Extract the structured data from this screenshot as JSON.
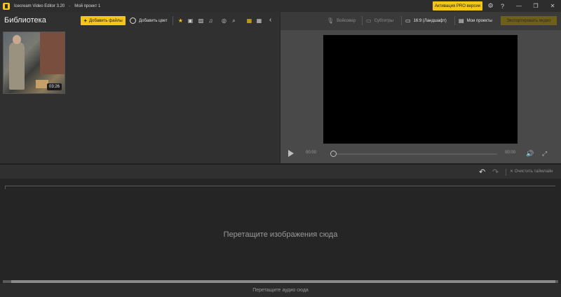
{
  "titlebar": {
    "app_name": "Icecream Video Editor 3.20",
    "separator": "-",
    "project_name": "Мой проект 1",
    "pro_button": "Активация PRO версии",
    "icons": [
      "gear-icon",
      "help-icon"
    ],
    "window_buttons": [
      "minimize",
      "maximize",
      "close"
    ]
  },
  "library": {
    "title": "Библиотека",
    "add_files": "Добавить файлы",
    "add_color": "Добавить цвет",
    "filters": [
      "star-icon",
      "video-icon",
      "image-icon",
      "music-icon",
      "color-icon",
      "search-icon",
      "grid-large-icon",
      "grid-small-icon"
    ],
    "items": [
      {
        "duration": "03:26"
      }
    ]
  },
  "preview": {
    "voiceover": "Войсовер",
    "subtitles": "Субтитры",
    "aspect": "16:9 (Ландшафт)",
    "my_projects": "Мои проекты",
    "export": "Экспортировать видео",
    "time_current": "00:00",
    "time_total": "00:00",
    "progress": 0
  },
  "timeline": {
    "clear": "Очистить таймлайн",
    "drop_images": "Перетащите изображения сюда",
    "drop_audio": "Перетащите аудио сюда"
  },
  "colors": {
    "accent": "#f5c518",
    "background": "#262626",
    "panel": "#303030"
  }
}
